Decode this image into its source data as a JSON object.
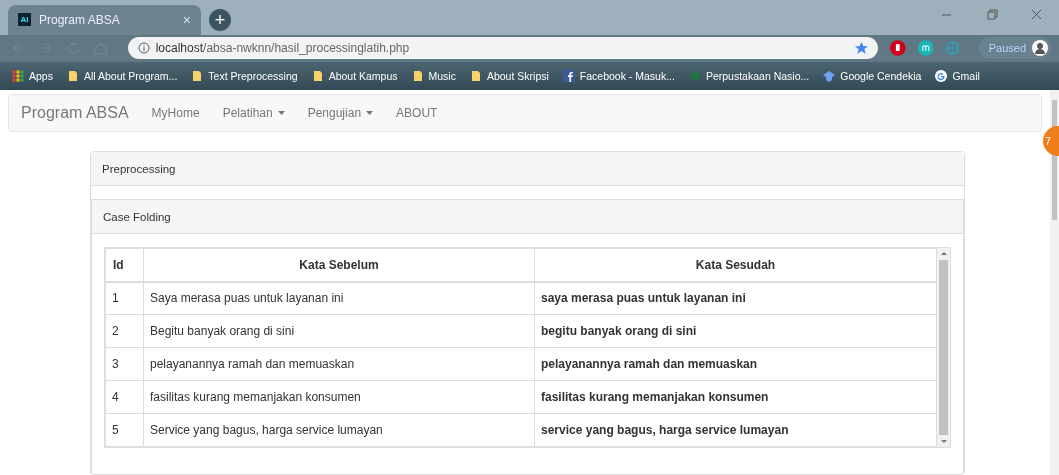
{
  "browser": {
    "tab": {
      "favicon": "AI",
      "title": "Program ABSA",
      "close": "×"
    },
    "new_tab": "+",
    "address": {
      "host": "localhost",
      "path": "/absa-nwknn/hasil_processinglatih.php"
    },
    "profile": {
      "label": "Paused"
    },
    "badge": "7",
    "bookmarks": [
      {
        "kind": "apps",
        "label": "Apps"
      },
      {
        "kind": "folder",
        "label": "All About Program..."
      },
      {
        "kind": "folder",
        "label": "Text Preprocessing"
      },
      {
        "kind": "folder",
        "label": "About Kampus"
      },
      {
        "kind": "folder",
        "label": "Music"
      },
      {
        "kind": "folder",
        "label": "About Skripsi"
      },
      {
        "kind": "facebook",
        "label": "Facebook - Masuk..."
      },
      {
        "kind": "star",
        "label": "Perpustakaan Nasio..."
      },
      {
        "kind": "cap",
        "label": "Google Cendekia"
      },
      {
        "kind": "google",
        "label": "Gmail"
      }
    ]
  },
  "navbar": {
    "brand": "Program ABSA",
    "items": [
      {
        "label": "MyHome",
        "dropdown": false
      },
      {
        "label": "Pelatihan",
        "dropdown": true
      },
      {
        "label": "Pengujian",
        "dropdown": true
      },
      {
        "label": "ABOUT",
        "dropdown": false
      }
    ]
  },
  "panel": {
    "title": "Preprocessing",
    "inner_title": "Case Folding",
    "table": {
      "columns": [
        "Id",
        "Kata Sebelum",
        "Kata Sesudah"
      ],
      "rows": [
        [
          "1",
          "Saya merasa puas untuk layanan ini",
          "saya merasa puas untuk layanan ini"
        ],
        [
          "2",
          "Begitu banyak orang di sini",
          "begitu banyak orang di sini"
        ],
        [
          "3",
          "pelayanannya ramah dan memuaskan",
          "pelayanannya ramah dan memuaskan"
        ],
        [
          "4",
          "fasilitas kurang memanjakan konsumen",
          "fasilitas kurang memanjakan konsumen"
        ],
        [
          "5",
          "Service yang bagus, harga service lumayan",
          "service yang bagus, harga service lumayan"
        ]
      ]
    }
  }
}
